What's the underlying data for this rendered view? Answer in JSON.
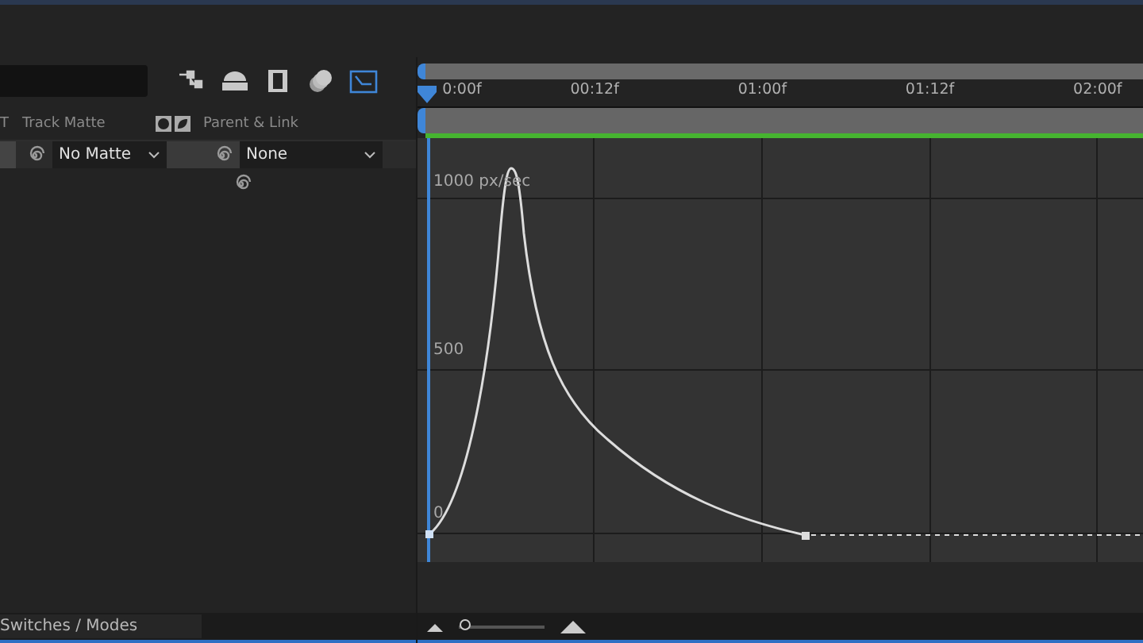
{
  "toolbar": [
    {
      "kind": "flowchart",
      "selected": false
    },
    {
      "kind": "dome",
      "selected": false
    },
    {
      "kind": "film",
      "selected": false
    },
    {
      "kind": "circles",
      "selected": false
    },
    {
      "kind": "graph",
      "selected": true
    }
  ],
  "columns": [
    "T",
    "Track Matte",
    "Parent & Link"
  ],
  "layer": {
    "track_matte": "No Matte",
    "parent": "None"
  },
  "ruler": [
    "0:00f",
    "00:12f",
    "01:00f",
    "01:12f",
    "02:00f"
  ],
  "graph_labels": [
    "1000 px/sec",
    "500",
    "0"
  ],
  "footer": {
    "toggle": "Switches / Modes",
    "zoom": {
      "level": 0.08
    }
  }
}
